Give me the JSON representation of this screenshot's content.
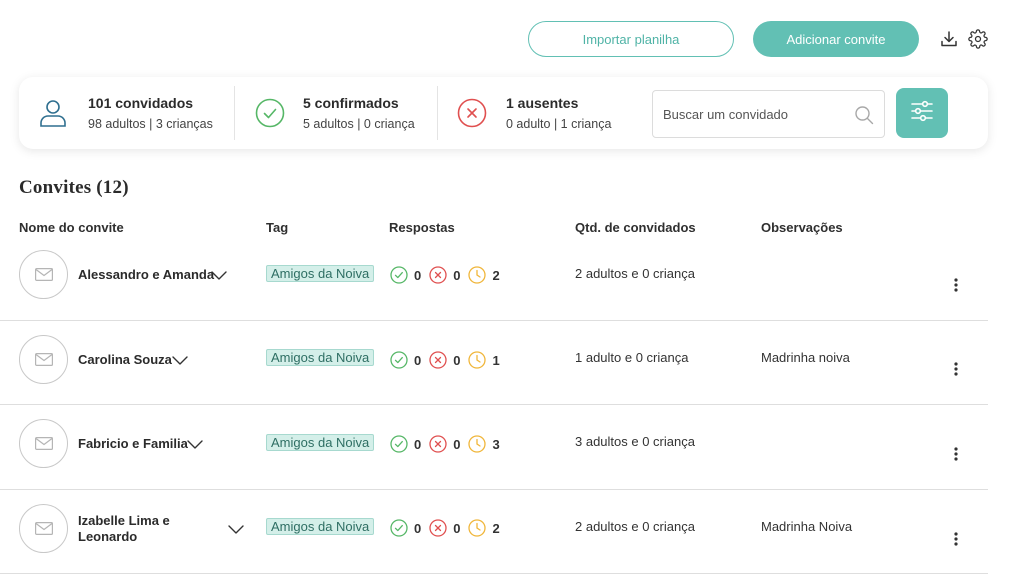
{
  "header": {
    "import_label": "Importar planilha",
    "add_label": "Adicionar convite",
    "accent_color": "#62c0b4"
  },
  "stats": {
    "guests_main": "101 convidados",
    "guests_sub": "98 adultos | 3 crianças",
    "confirmed_main": "5 confirmados",
    "confirmed_sub": "5 adultos | 0 criança",
    "absent_main": "1 ausentes",
    "absent_sub": "0 adulto | 1 criança"
  },
  "search": {
    "placeholder": "Buscar um convidado"
  },
  "section_title": "Convites (12)",
  "columns": {
    "name": "Nome do convite",
    "tag": "Tag",
    "responses": "Respostas",
    "qty": "Qtd. de convidados",
    "notes": "Observações"
  },
  "rows": [
    {
      "name": "Alessandro e Amanda",
      "tag": "Amigos da Noiva",
      "confirmed": "0",
      "declined": "0",
      "pending": "2",
      "qty": "2 adultos e 0 criança",
      "notes": ""
    },
    {
      "name": "Carolina Souza",
      "tag": "Amigos da Noiva",
      "confirmed": "0",
      "declined": "0",
      "pending": "1",
      "qty": "1 adulto e 0 criança",
      "notes": "Madrinha noiva"
    },
    {
      "name": "Fabricio e Familia",
      "tag": "Amigos da Noiva",
      "confirmed": "0",
      "declined": "0",
      "pending": "3",
      "qty": "3 adultos e 0 criança",
      "notes": ""
    },
    {
      "name": "Izabelle Lima e Leonardo",
      "tag": "Amigos da Noiva",
      "confirmed": "0",
      "declined": "0",
      "pending": "2",
      "qty": "2 adultos e 0 criança",
      "notes": "Madrinha Noiva"
    }
  ],
  "icons": {
    "download": "download-icon",
    "settings": "gear-icon",
    "user": "user-icon",
    "check": "check-circle-icon",
    "cross": "x-circle-icon",
    "clock": "clock-icon",
    "envelope": "envelope-icon",
    "search": "search-icon",
    "filter": "sliders-icon",
    "chevron": "chevron-down-icon",
    "menu": "kebab-menu-icon"
  },
  "colors": {
    "confirmed": "#56b767",
    "declined": "#e05050",
    "pending": "#f0b63a",
    "tag_bg": "#d4efe9"
  }
}
